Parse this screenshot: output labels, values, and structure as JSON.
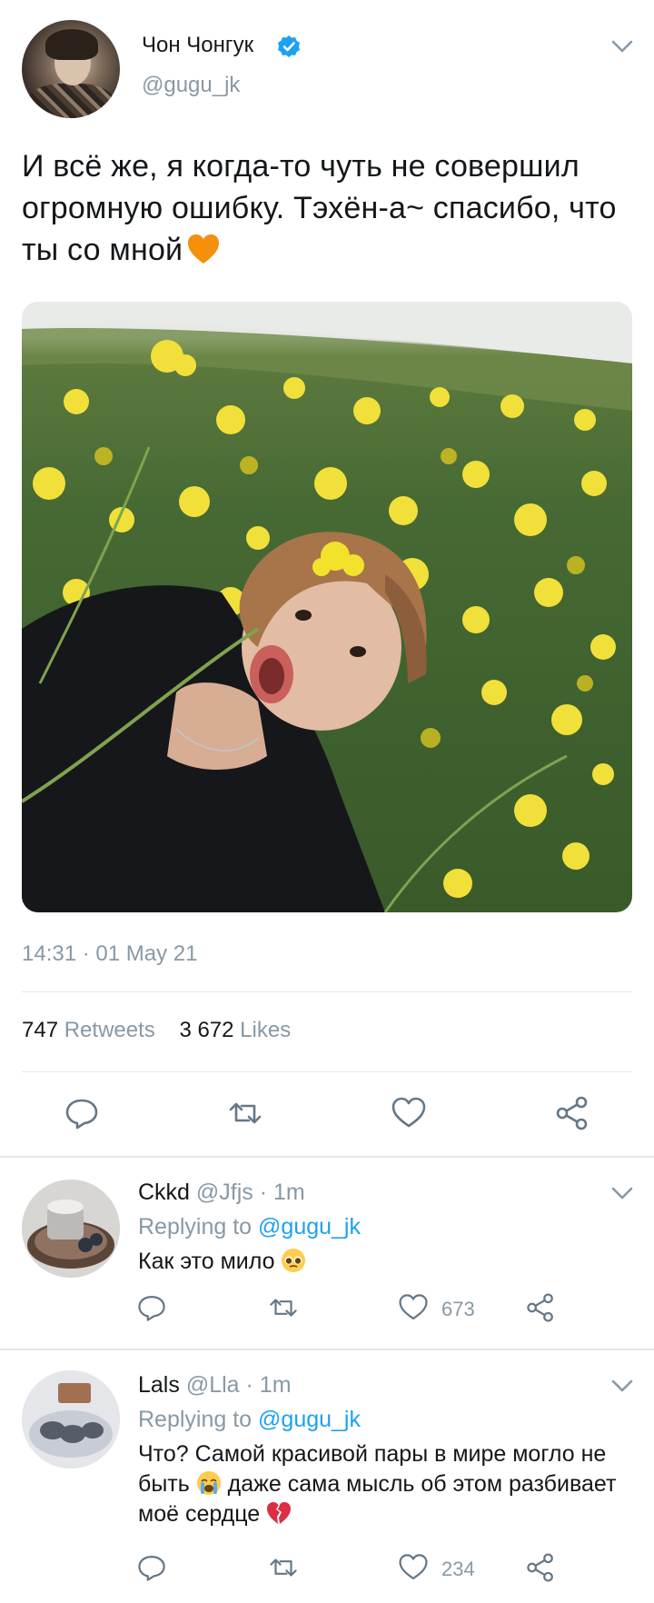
{
  "tweet": {
    "display_name": "Чон Чонгук",
    "handle": "@gugu_jk",
    "text": "И всё же, я когда-то чуть не совершил огромную ошибку. Тэхён-а~ спасибо, что ты со мной",
    "timestamp": "14:31 · 01 May 21",
    "retweets_count": "747",
    "retweets_label": "Retweets",
    "likes_count": "3 672",
    "likes_label": "Likes",
    "icons": [
      "reply-icon",
      "retweet-icon",
      "like-icon",
      "share-icon",
      "verified-icon",
      "chevron-down-icon",
      "orange-heart-emoji"
    ]
  },
  "replies": [
    {
      "name": "Ckkd",
      "meta": "@Jfjs · 1m",
      "replying_prefix": "Replying to",
      "replying_mention": "@gugu_jk",
      "text": "Как это мило",
      "likes": "673",
      "emoji": "pleading-face-emoji"
    },
    {
      "name": "Lals",
      "meta": "@Lla · 1m",
      "replying_prefix": "Replying to",
      "replying_mention": "@gugu_jk",
      "text_part1": "Что? Самой красивой пары в мире могло не быть",
      "text_part2": "даже сама мысль об этом разбивает моё сердце",
      "likes": "234",
      "emojis": [
        "crying-face-emoji",
        "broken-heart-emoji"
      ]
    }
  ],
  "colors": {
    "accent": "#1da1f2",
    "muted": "#8899a6",
    "text": "#14171a",
    "divider": "#e1e8ed"
  }
}
